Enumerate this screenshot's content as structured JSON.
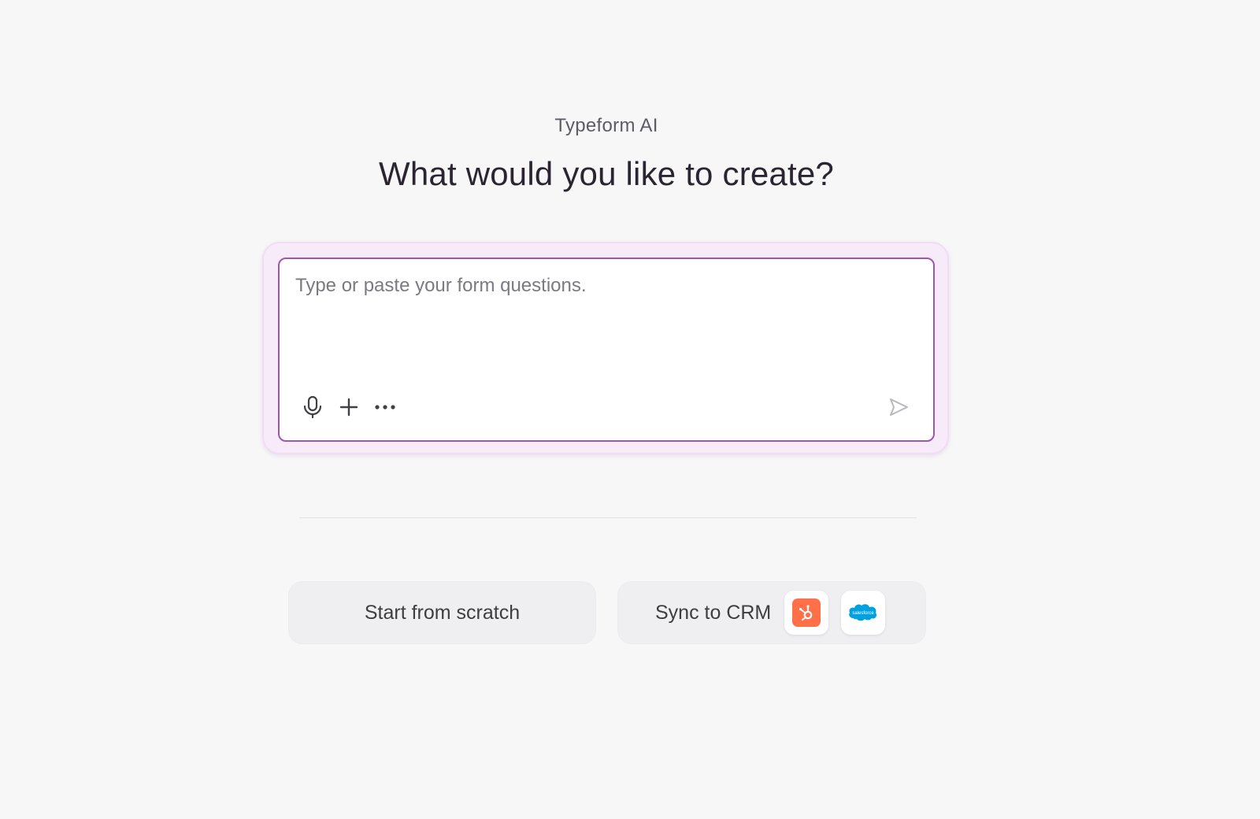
{
  "header": {
    "eyebrow": "Typeform AI",
    "title": "What would you like to create?"
  },
  "composer": {
    "placeholder": "Type or paste your form questions.",
    "value": "",
    "tools": [
      {
        "name": "microphone-icon"
      },
      {
        "name": "plus-icon"
      },
      {
        "name": "more-icon"
      }
    ],
    "send_icon": "send-icon"
  },
  "actions": {
    "start_scratch_label": "Start from scratch",
    "sync_crm_label": "Sync to CRM",
    "crm_integrations": [
      {
        "name": "hubspot-icon"
      },
      {
        "name": "salesforce-icon",
        "logo_text": "salesforce"
      }
    ]
  },
  "colors": {
    "background": "#f7f7f8",
    "composer_glow": "#f8ebf9",
    "composer_border": "#9b57b3",
    "hubspot": "#ff6f48",
    "salesforce": "#00a1e0"
  }
}
